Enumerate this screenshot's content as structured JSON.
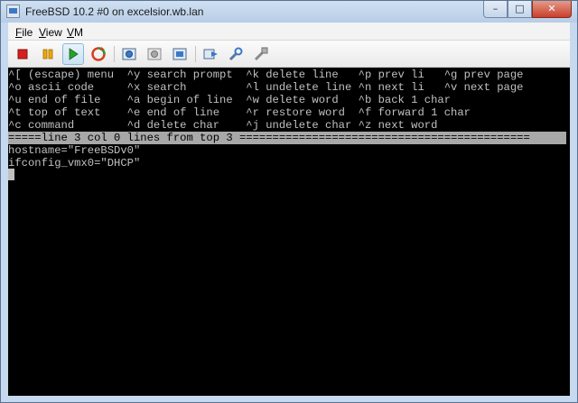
{
  "window": {
    "title": "FreeBSD 10.2 #0 on excelsior.wb.lan",
    "controls": {
      "minimize": "–",
      "maximize": "□",
      "close": "✕"
    }
  },
  "menubar": {
    "items": [
      {
        "label_mnemonic": "F",
        "label_rest": "ile"
      },
      {
        "label_mnemonic": "V",
        "label_rest": "iew",
        "label_prefix": ""
      },
      {
        "label_mnemonic": "V",
        "label_rest": "M"
      }
    ]
  },
  "toolbar": {
    "buttons": [
      {
        "icon": "stop-icon",
        "color": "#d42020"
      },
      {
        "icon": "pause-icon",
        "color": "#e8a000"
      },
      {
        "icon": "play-icon",
        "color": "#2aa02a",
        "state": "active"
      },
      {
        "icon": "reset-icon",
        "color": "#2a9a2a"
      },
      {
        "icon": "snapshot-icon"
      },
      {
        "icon": "revert-snapshot-icon"
      },
      {
        "icon": "snapshot-manager-icon"
      },
      {
        "icon": "send-keys-icon"
      },
      {
        "icon": "settings-icon"
      },
      {
        "icon": "tools-icon"
      }
    ]
  },
  "console": {
    "help_lines": [
      "^[ (escape) menu  ^y search prompt  ^k delete line   ^p prev li   ^g prev page",
      "^o ascii code     ^x search         ^l undelete line ^n next li   ^v next page",
      "^u end of file    ^a begin of line  ^w delete word   ^b back 1 char",
      "^t top of text    ^e end of line    ^r restore word  ^f forward 1 char",
      "^c command        ^d delete char    ^j undelete char ^z next word"
    ],
    "status_line": "=====line 3 col 0 lines from top 3 ============================================",
    "file_lines": [
      "hostname=\"FreeBSDv0\"",
      "ifconfig_vmx0=\"DHCP\""
    ],
    "colors": {
      "background": "#000000",
      "text": "#c0c0c0",
      "status_bg": "#a8a8a8"
    }
  }
}
